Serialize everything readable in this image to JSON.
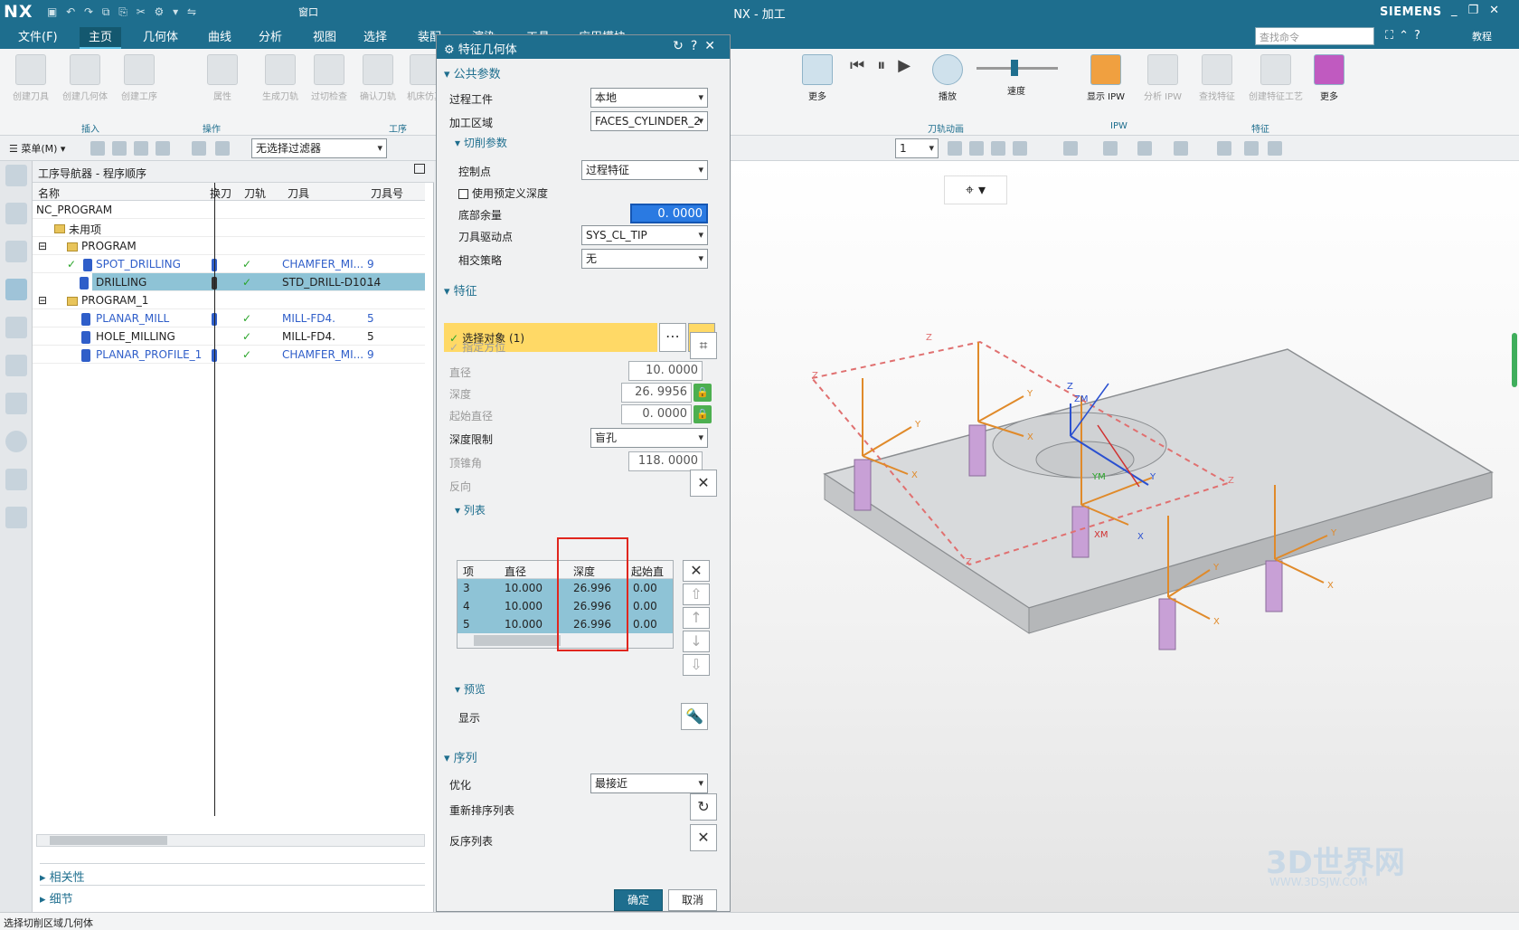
{
  "titlebar": {
    "logo": "NX",
    "title": "NX - 加工",
    "brand": "SIEMENS",
    "window_menu": "窗口"
  },
  "menu": {
    "items": [
      "文件(F)",
      "主页",
      "几何体",
      "曲线",
      "分析",
      "视图",
      "选择",
      "装配",
      "渲染",
      "工具",
      "应用模块"
    ],
    "active": "主页",
    "search_placeholder": "查找命令",
    "tutorial": "教程"
  },
  "ribbon": {
    "buttons": [
      "创建刀具",
      "创建几何体",
      "创建工序",
      "属性",
      "生成刀轨",
      "过切检查",
      "确认刀轨",
      "机床仿真",
      "更多",
      "播放",
      "显示 IPW",
      "分析 IPW",
      "查找特征",
      "创建特征工艺",
      "更多"
    ],
    "speed_label": "速度",
    "groups": [
      "插入",
      "操作",
      "工序",
      "刀轨动画",
      "IPW",
      "特征"
    ]
  },
  "toolbar": {
    "menu_label": "菜单(M)",
    "filter": "无选择过滤器",
    "layer_value": "1"
  },
  "navigator": {
    "title": "工序导航器 - 程序顺序",
    "columns": [
      "名称",
      "换刀",
      "刀轨",
      "刀具",
      "刀具号"
    ],
    "rows": [
      {
        "name": "NC_PROGRAM",
        "tool": "",
        "num": ""
      },
      {
        "name": "未用项",
        "tool": "",
        "num": ""
      },
      {
        "name": "PROGRAM",
        "tool": "",
        "num": ""
      },
      {
        "name": "SPOT_DRILLING",
        "tool": "CHAMFER_MI...",
        "num": "9"
      },
      {
        "name": "DRILLING",
        "tool": "STD_DRILL-D10...",
        "num": "14"
      },
      {
        "name": "PROGRAM_1",
        "tool": "",
        "num": ""
      },
      {
        "name": "PLANAR_MILL",
        "tool": "MILL-FD4.",
        "num": "5"
      },
      {
        "name": "HOLE_MILLING",
        "tool": "MILL-FD4.",
        "num": "5"
      },
      {
        "name": "PLANAR_PROFILE_1",
        "tool": "CHAMFER_MI...",
        "num": "9"
      }
    ],
    "footer": [
      "相关性",
      "细节"
    ]
  },
  "dialog": {
    "title": "特征几何体",
    "sections": {
      "common": "公共参数",
      "cut": "切削参数",
      "feature": "特征",
      "list": "列表",
      "preview": "预览",
      "sequence": "序列"
    },
    "process_workpiece_label": "过程工件",
    "process_workpiece": "本地",
    "machining_area_label": "加工区域",
    "machining_area": "FACES_CYLINDER_2",
    "control_point_label": "控制点",
    "control_point": "过程特征",
    "use_predefined_depth": "使用预定义深度",
    "bottom_stock_label": "底部余量",
    "bottom_stock": "0. 0000",
    "tool_drive_point_label": "刀具驱动点",
    "tool_drive_point": "SYS_CL_TIP",
    "intersect_label": "相交策略",
    "intersect": "无",
    "select_object": "选择对象 (1)",
    "specify_orientation": "指定方位",
    "diameter_label": "直径",
    "diameter": "10. 0000",
    "depth_label": "深度",
    "depth": "26. 9956",
    "start_diameter_label": "起始直径",
    "start_diameter": "0. 0000",
    "depth_limit_label": "深度限制",
    "depth_limit": "盲孔",
    "tip_angle_label": "顶锥角",
    "tip_angle": "118. 0000",
    "reverse_label": "反向",
    "list_columns": [
      "项",
      "直径",
      "深度",
      "起始直径"
    ],
    "list_rows": [
      {
        "item": "3",
        "diameter": "10.000",
        "depth": "26.996",
        "start": "0.00"
      },
      {
        "item": "4",
        "diameter": "10.000",
        "depth": "26.996",
        "start": "0.00"
      },
      {
        "item": "5",
        "diameter": "10.000",
        "depth": "26.996",
        "start": "0.00"
      }
    ],
    "display_label": "显示",
    "optimize_label": "优化",
    "optimize": "最接近",
    "reorder_label": "重新排序列表",
    "reverse_list_label": "反序列表",
    "ok": "确定",
    "cancel": "取消"
  },
  "viewport": {
    "axis_labels": [
      "Z",
      "Z",
      "Z",
      "Z",
      "Y",
      "Y",
      "Y",
      "Y",
      "X",
      "X",
      "X",
      "X",
      "ZM",
      "YM",
      "XM",
      "Y",
      "X",
      "Z"
    ],
    "watermark_cn": "3D世界网",
    "watermark_url": "WWW.3DSJW.COM"
  },
  "status": {
    "text": "选择切削区域几何体"
  },
  "colors": {
    "title_bar": "#1e6e8e",
    "highlight_row": "#8ec3d6",
    "select_bar": "#ffd966",
    "red_box": "#e0261e"
  }
}
